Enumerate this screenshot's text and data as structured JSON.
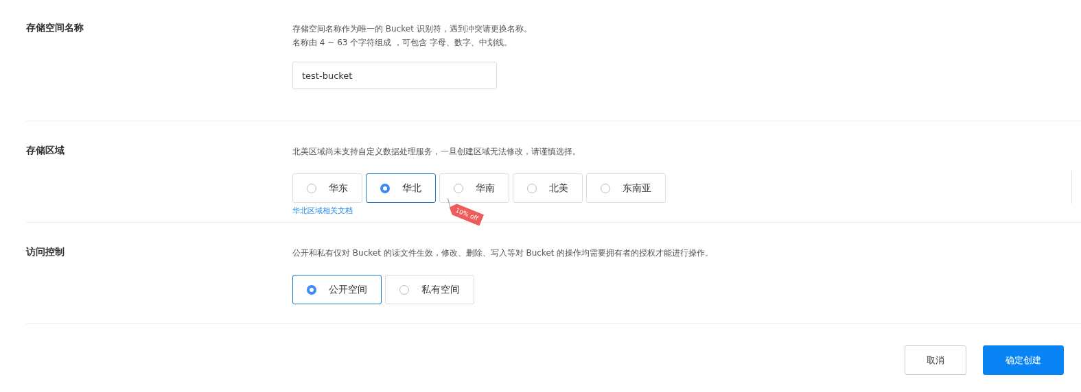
{
  "sections": [
    {
      "kind": "text-input",
      "label": "存储空间名称",
      "description": [
        "存储空间名称作为唯一的 Bucket 识别符，遇到冲突请更换名称。",
        "名称由 4 ~ 63 个字符组成 ，可包含 字母、数字、中划线。"
      ],
      "value": "test-bucket"
    },
    {
      "kind": "radio-group",
      "label": "存储区域",
      "description": [
        "北美区域尚未支持自定义数据处理服务，一旦创建区域无法修改，请谨慎选择。"
      ],
      "options": [
        {
          "label": "华东",
          "selected": false
        },
        {
          "label": "华北",
          "selected": true
        },
        {
          "label": "华南",
          "selected": false,
          "badge": "10% off"
        },
        {
          "label": "北美",
          "selected": false
        },
        {
          "label": "东南亚",
          "selected": false
        }
      ],
      "link": "华北区域相关文档"
    },
    {
      "kind": "radio-group",
      "label": "访问控制",
      "description": [
        "公开和私有仅对 Bucket 的读文件生效，修改、删除、写入等对 Bucket 的操作均需要拥有者的授权才能进行操作。"
      ],
      "options": [
        {
          "label": "公开空间",
          "selected": true
        },
        {
          "label": "私有空间",
          "selected": false
        }
      ]
    }
  ],
  "buttons": [
    {
      "label": "取消",
      "kind": "secondary"
    },
    {
      "label": "确定创建",
      "kind": "primary"
    }
  ]
}
